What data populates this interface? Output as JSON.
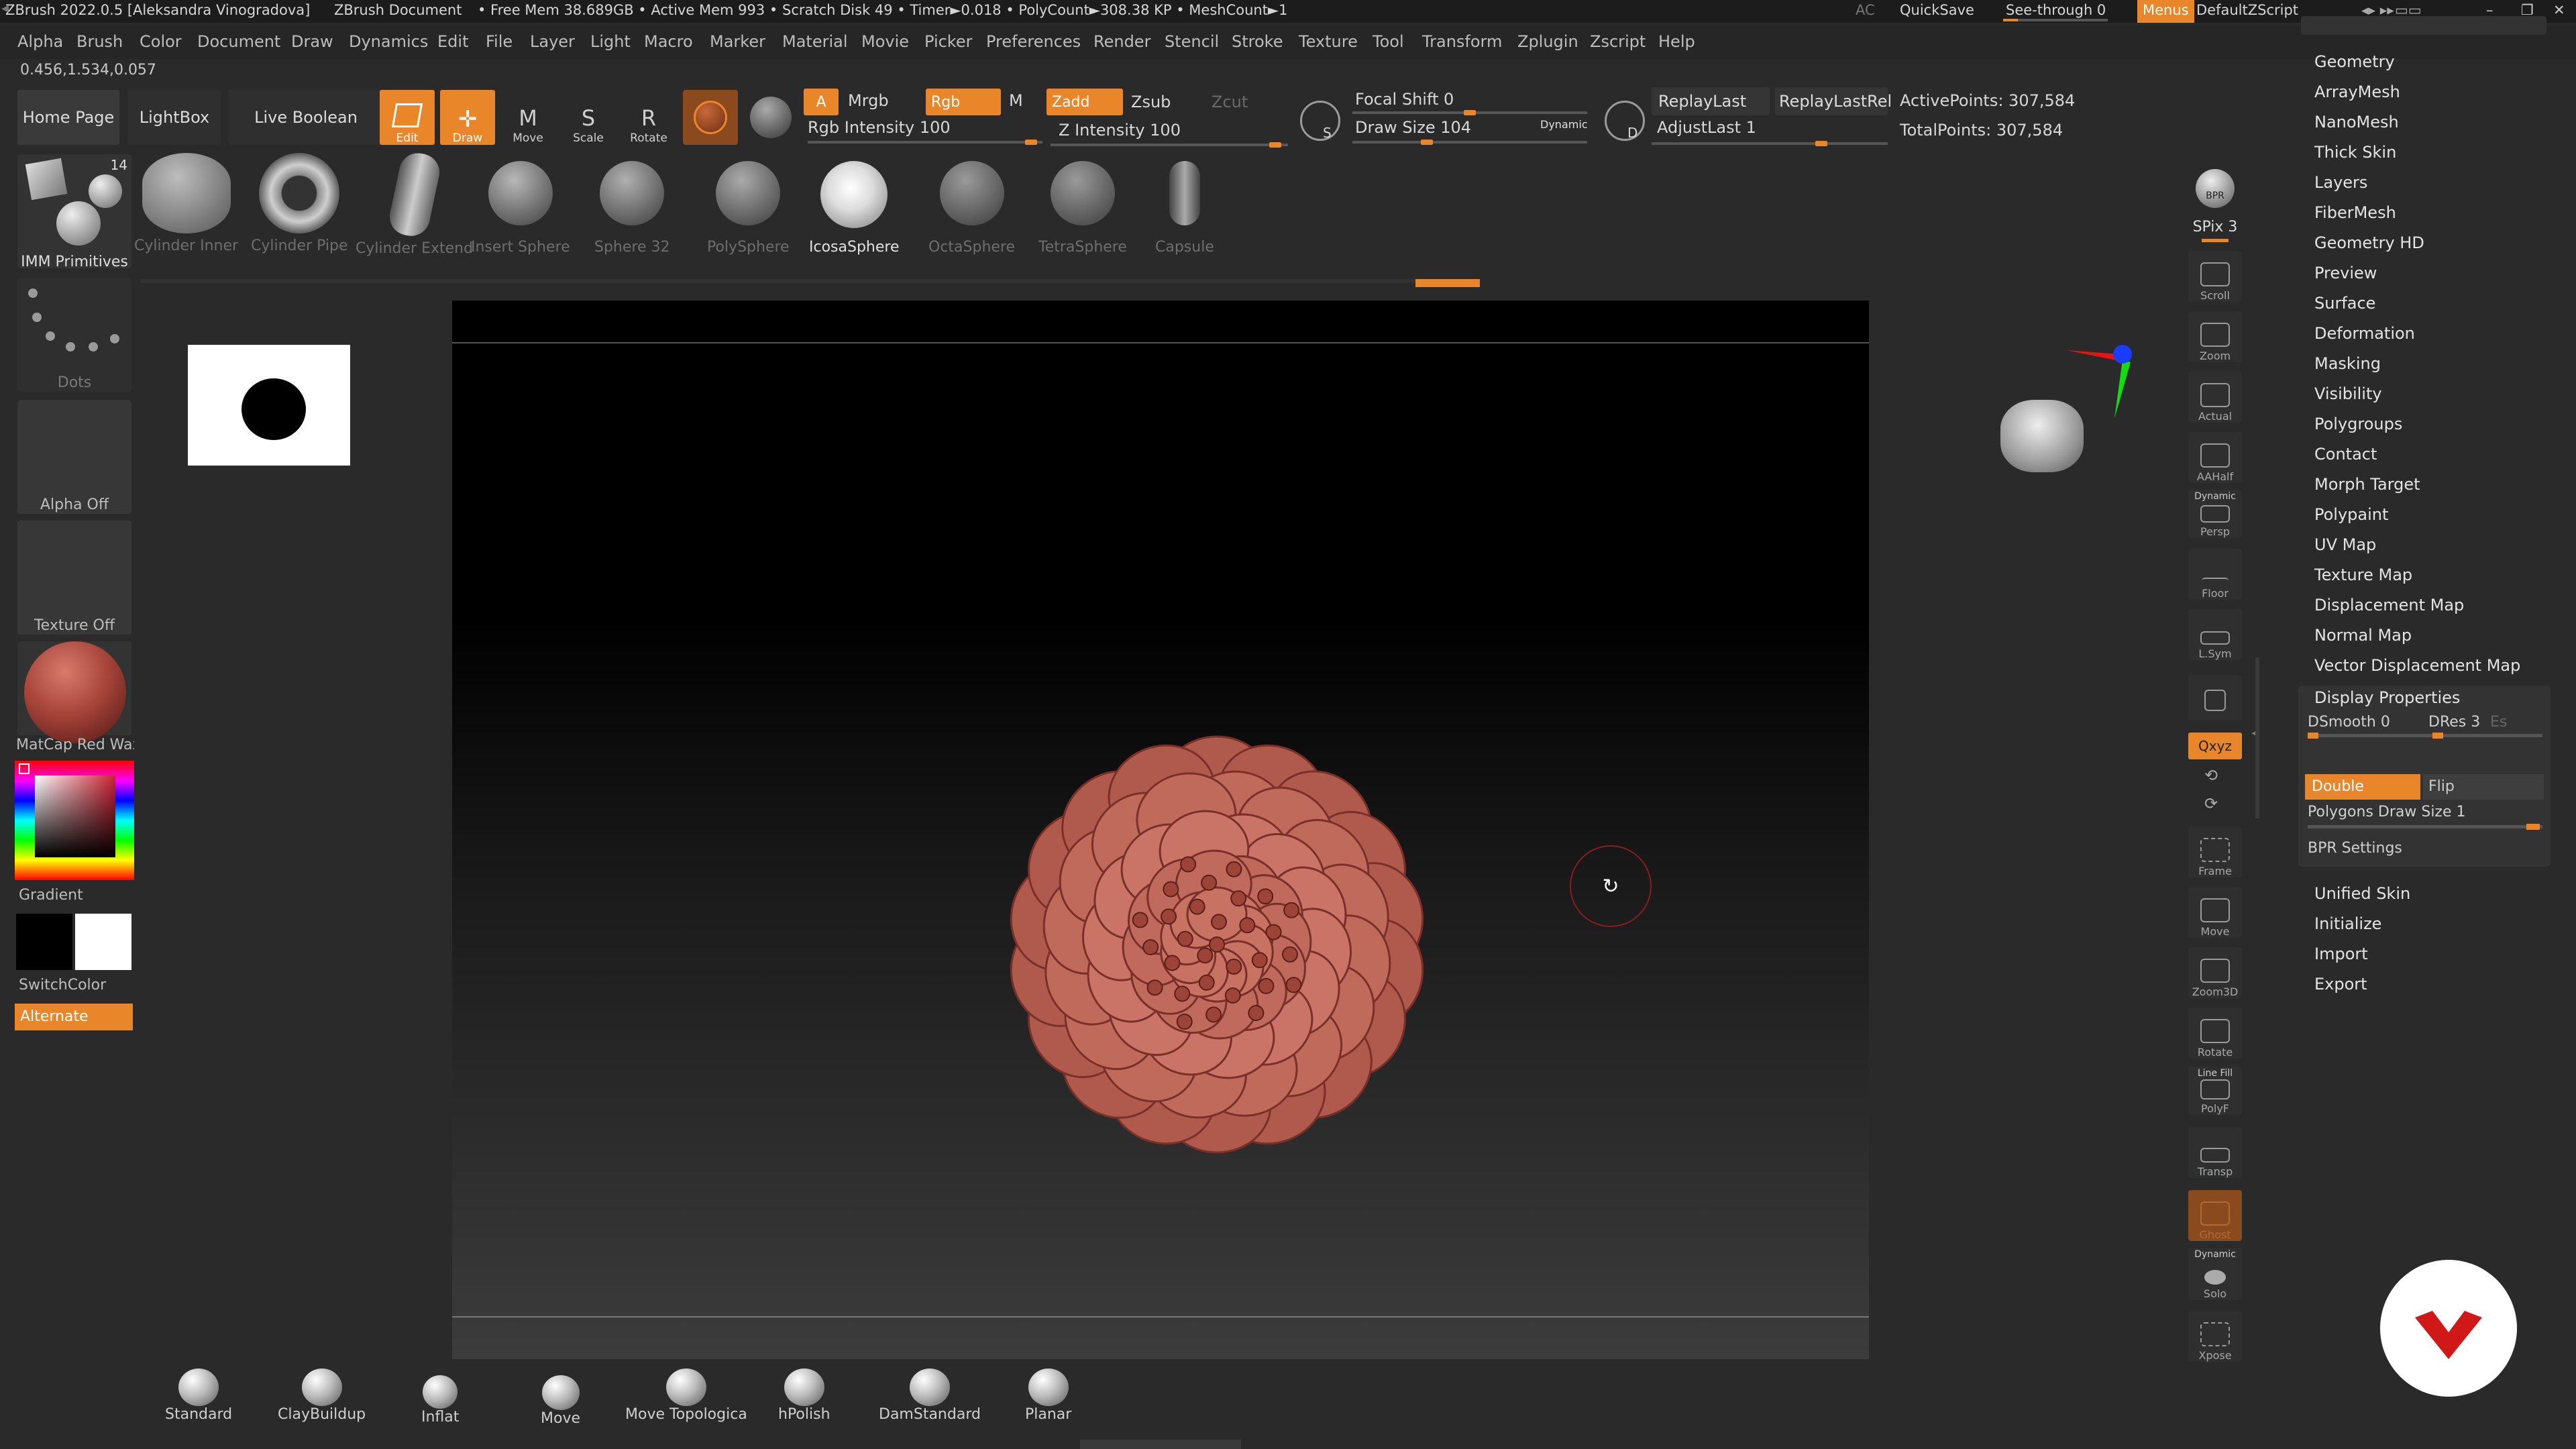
{
  "titlebar": {
    "app": "ZBrush 2022.0.5 [Aleksandra Vinogradova]",
    "doc": "ZBrush Document",
    "stats": "• Free Mem 38.689GB • Active Mem 993 • Scratch Disk 49 • Timer►0.018 • PolyCount►308.38 KP • MeshCount►1",
    "ac": "AC",
    "quicksave": "QuickSave",
    "seethrough": "See-through  0",
    "menus": "Menus",
    "script": "DefaultZScript"
  },
  "menu": [
    "Alpha",
    "Brush",
    "Color",
    "Document",
    "Draw",
    "Dynamics",
    "Edit",
    "File",
    "Layer",
    "Light",
    "Macro",
    "Marker",
    "Material",
    "Movie",
    "Picker",
    "Preferences",
    "Render",
    "Stencil",
    "Stroke",
    "Texture",
    "Tool",
    "Transform",
    "Zplugin",
    "Zscript",
    "Help"
  ],
  "coords": "0.456,1.534,0.057",
  "shelf": {
    "home": "Home Page",
    "lightbox": "LightBox",
    "liveboolean": "Live Boolean",
    "edit": "Edit",
    "draw": "Draw",
    "move": "Move",
    "scale": "Scale",
    "rotate": "Rotate",
    "a": "A",
    "mrgb": "Mrgb",
    "rgb": "Rgb",
    "m": "M",
    "zadd": "Zadd",
    "zsub": "Zsub",
    "zcut": "Zcut",
    "rgb_intensity": "Rgb Intensity 100",
    "z_intensity": "Z Intensity 100",
    "focal_shift": "Focal Shift 0",
    "draw_size": "Draw Size 104",
    "dynamic": "Dynamic",
    "replaylast": "ReplayLast",
    "replaylastrel": "ReplayLastRel",
    "adjustlast": "AdjustLast 1",
    "active_points": "ActivePoints: 307,584",
    "total_points": "TotalPoints: 307,584",
    "s": "S",
    "d": "D"
  },
  "primitives": [
    {
      "label": "Cylinder Inner",
      "active": false
    },
    {
      "label": "Cylinder Pipe",
      "active": false
    },
    {
      "label": "Cylinder Extend",
      "active": false
    },
    {
      "label": "Insert Sphere",
      "active": false
    },
    {
      "label": "Sphere 32",
      "active": false
    },
    {
      "label": "PolySphere",
      "active": false
    },
    {
      "label": "IcosaSphere",
      "active": true
    },
    {
      "label": "OctaSphere",
      "active": false
    },
    {
      "label": "TetraSphere",
      "active": false
    },
    {
      "label": "Capsule",
      "active": false
    }
  ],
  "lefttray": {
    "imm": "IMM Primitives",
    "imm_count": "14",
    "dots": "Dots",
    "alpha": "Alpha Off",
    "texture": "Texture Off",
    "matcap": "MatCap Red Wax",
    "gradient": "Gradient",
    "switchcolor": "SwitchColor",
    "alternate": "Alternate"
  },
  "righttools": {
    "bpr": "BPR",
    "spix": "SPix 3",
    "scroll": "Scroll",
    "zoom": "Zoom",
    "actual": "Actual",
    "aahalf": "AAHalf",
    "dynamic": "Dynamic",
    "persp": "Persp",
    "floor": "Floor",
    "lsym": "L.Sym",
    "qxyz": "Qxyz",
    "frame": "Frame",
    "move": "Move",
    "zoom3d": "Zoom3D",
    "rotate": "Rotate",
    "linefill": "Line Fill",
    "polyf": "PolyF",
    "transp": "Transp",
    "ghost": "Ghost",
    "dynamic2": "Dynamic",
    "solo": "Solo",
    "xpose": "Xpose"
  },
  "palette": {
    "items": [
      "Geometry",
      "ArrayMesh",
      "NanoMesh",
      "Thick Skin",
      "Layers",
      "FiberMesh",
      "Geometry HD",
      "Preview",
      "Surface",
      "Deformation",
      "Masking",
      "Visibility",
      "Polygroups",
      "Contact",
      "Morph Target",
      "Polypaint",
      "UV Map",
      "Texture Map",
      "Displacement Map",
      "Normal Map",
      "Vector Displacement Map"
    ],
    "display_properties": "Display Properties",
    "dsmooth": "DSmooth 0",
    "dres": "DRes 3",
    "es": "Es",
    "double": "Double",
    "flip": "Flip",
    "poly_draw_size": "Polygons Draw Size 1",
    "bpr_settings": "BPR Settings",
    "after": [
      "Unified Skin",
      "Initialize",
      "Import",
      "Export"
    ]
  },
  "brushes": [
    "Standard",
    "ClayBuildup",
    "Inflat",
    "Move",
    "Move Topologica",
    "hPolish",
    "DamStandard",
    "Planar"
  ],
  "colors": {
    "accent": "#e9862a",
    "matcap": "#a8453a",
    "flower": "#c97466"
  }
}
